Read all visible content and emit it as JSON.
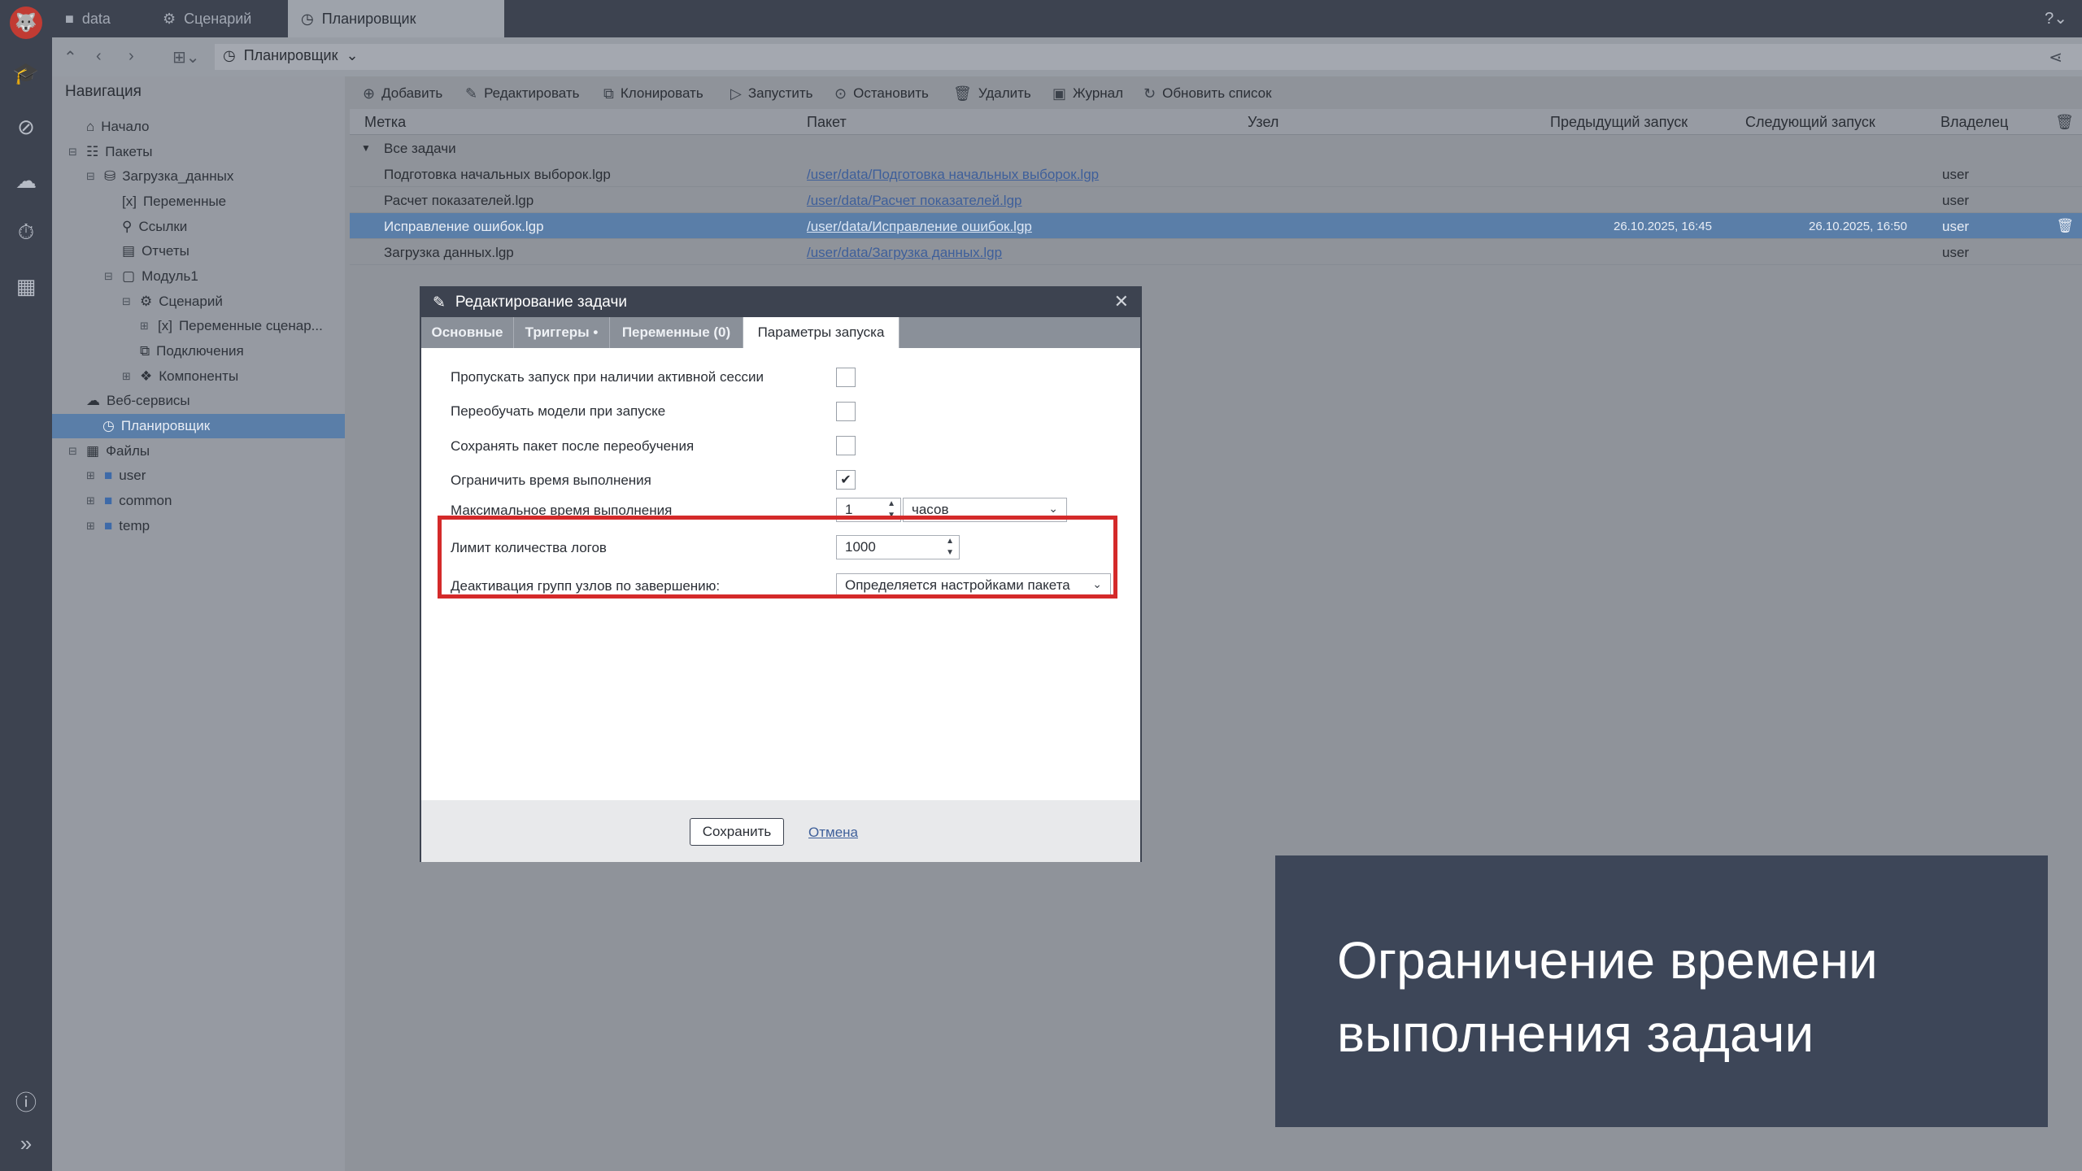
{
  "app": {
    "logo_text": "🐺"
  },
  "tabs": [
    {
      "label": "data",
      "icon": "folder-icon"
    },
    {
      "label": "Сценарий",
      "icon": "scenario-icon"
    },
    {
      "label": "Планировщик",
      "icon": "scheduler-icon"
    }
  ],
  "address": {
    "crumb": "Планировщик"
  },
  "navigation": {
    "title": "Навигация",
    "items": [
      {
        "label": "Начало"
      },
      {
        "label": "Пакеты"
      },
      {
        "label": "Загрузка_данных"
      },
      {
        "label": "Переменные"
      },
      {
        "label": "Ссылки"
      },
      {
        "label": "Отчеты"
      },
      {
        "label": "Модуль1"
      },
      {
        "label": "Сценарий"
      },
      {
        "label": "Переменные сценар..."
      },
      {
        "label": "Подключения"
      },
      {
        "label": "Компоненты"
      },
      {
        "label": "Веб-сервисы"
      },
      {
        "label": "Планировщик"
      },
      {
        "label": "Файлы"
      },
      {
        "label": "user"
      },
      {
        "label": "common"
      },
      {
        "label": "temp"
      }
    ]
  },
  "toolbar": {
    "add": "Добавить",
    "edit": "Редактировать",
    "clone": "Клонировать",
    "run": "Запустить",
    "stop": "Остановить",
    "delete": "Удалить",
    "log": "Журнал",
    "refresh": "Обновить список"
  },
  "grid": {
    "columns": [
      "Метка",
      "Пакет",
      "Узел",
      "Предыдущий запуск",
      "Следующий запуск",
      "Владелец"
    ],
    "group": "Все задачи",
    "rows": [
      {
        "label": "Подготовка начальных выборок.lgp",
        "package": "/user/data/Подготовка начальных выборок.lgp",
        "node": "",
        "prev": "",
        "next": "",
        "owner": "user"
      },
      {
        "label": "Расчет показателей.lgp",
        "package": "/user/data/Расчет показателей.lgp",
        "node": "",
        "prev": "",
        "next": "",
        "owner": "user"
      },
      {
        "label": "Исправление ошибок.lgp",
        "package": "/user/data/Исправление ошибок.lgp",
        "node": "",
        "prev": "26.10.2025, 16:45",
        "next": "26.10.2025, 16:50",
        "owner": "user"
      },
      {
        "label": "Загрузка данных.lgp",
        "package": "/user/data/Загрузка данных.lgp",
        "node": "",
        "prev": "",
        "next": "",
        "owner": "user"
      }
    ]
  },
  "dialog": {
    "title": "Редактирование задачи",
    "tabs": [
      "Основные",
      "Триггеры •",
      "Переменные (0)",
      "Параметры запуска"
    ],
    "fields": {
      "skip_active": "Пропускать запуск при наличии активной сессии",
      "retrain": "Переобучать модели при запуске",
      "save_package": "Сохранять пакет после переобучения",
      "limit_time": "Ограничить время выполнения",
      "max_time": "Максимальное время выполнения",
      "max_time_value": "1",
      "max_time_unit": "часов",
      "log_limit": "Лимит количества логов",
      "log_limit_value": "1000",
      "deactivate_groups": "Деактивация групп узлов по завершению:",
      "deactivate_value": "Определяется настройками пакета"
    },
    "checks": {
      "skip_active": false,
      "retrain": false,
      "save_package": false,
      "limit_time": true
    },
    "save": "Сохранить",
    "cancel": "Отмена"
  },
  "caption": {
    "line1": "Ограничение времени",
    "line2": "выполнения задачи"
  },
  "colors": {
    "highlight": "#d42a2a",
    "selection": "#5a7ea8",
    "dark": "#3d4350"
  }
}
